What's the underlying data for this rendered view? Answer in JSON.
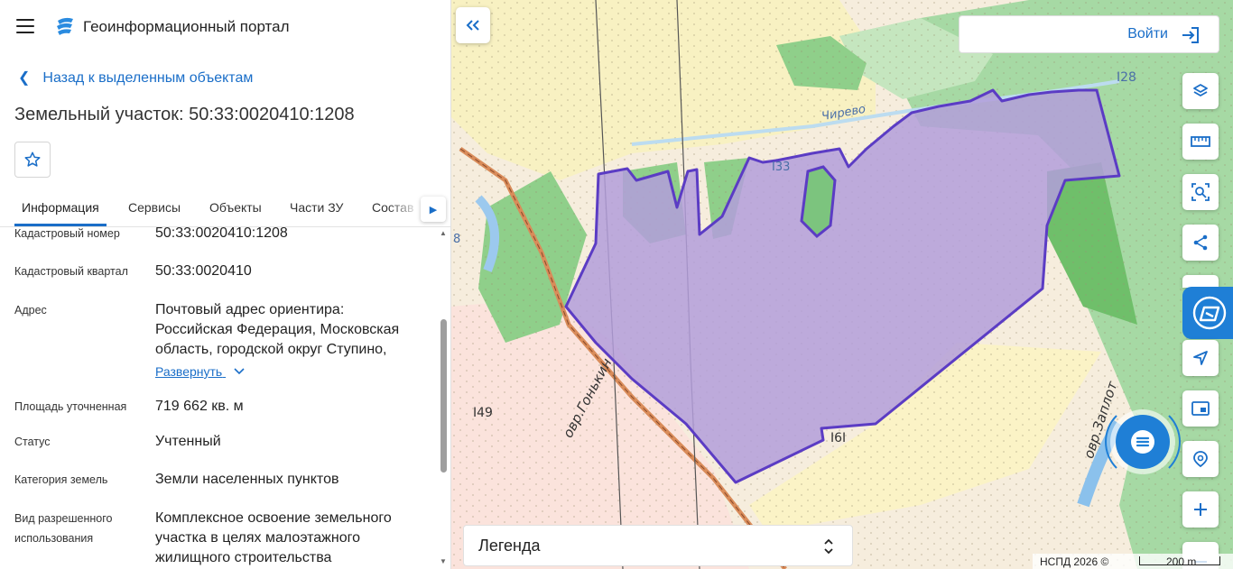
{
  "header": {
    "app_title": "Геоинформационный портал"
  },
  "nav": {
    "back_label": "Назад к выделенным объектам"
  },
  "object": {
    "title": "Земельный участок: 50:33:0020410:1208"
  },
  "tabs": [
    {
      "label": "Информация",
      "active": true
    },
    {
      "label": "Сервисы"
    },
    {
      "label": "Объекты"
    },
    {
      "label": "Части ЗУ"
    },
    {
      "label": "Состав"
    }
  ],
  "props": {
    "cad_number": {
      "label": "Кадастровый номер",
      "value": "50:33:0020410:1208"
    },
    "cad_quarter": {
      "label": "Кадастровый квартал",
      "value": "50:33:0020410"
    },
    "address": {
      "label": "Адрес",
      "line1": "Почтовый адрес ориентира:",
      "line2": "Российская Федерация, Московская",
      "line3": "область, городской округ Ступино,",
      "expand": "Развернуть"
    },
    "area": {
      "label": "Площадь уточненная",
      "value": "719 662 кв. м"
    },
    "status": {
      "label": "Статус",
      "value": "Учтенный"
    },
    "category": {
      "label": "Категория земель",
      "value": "Земли населенных пунктов"
    },
    "usage": {
      "label1": "Вид разрешенного",
      "label2": "использования",
      "line1": "Комплексное освоение земельного",
      "line2": "участка в целях малоэтажного",
      "line3": "жилищного строительства"
    }
  },
  "map": {
    "login_label": "Войти",
    "legend_title": "Легенда",
    "copyright": "НСПД 2026 ©",
    "scale": "200 m",
    "labels": {
      "l128": "I28",
      "l133": "I33",
      "l149": "I49",
      "l161": "I6I",
      "l8": "8",
      "river": "Чирево",
      "ravine1": "овр.Гонькин",
      "ravine2": "овр.Заплот"
    },
    "colors": {
      "parcel_fill": "#b39ddb",
      "parcel_stroke": "#5b3cc4",
      "forest": "#7cc47e",
      "accent": "#1f7fd6"
    }
  },
  "icons": {
    "menu": "menu-icon",
    "logo": "portal-logo-icon",
    "star": "star-icon",
    "layers": "layers-icon",
    "ruler": "ruler-icon",
    "select_area": "select-area-icon",
    "share": "share-icon",
    "feedback": "feedback-icon",
    "locate": "locate-icon",
    "print": "print-icon",
    "search_map": "search-map-icon",
    "zoom_in": "zoom-in-icon",
    "zoom_out": "zoom-out-icon",
    "chat": "chat-icon"
  }
}
